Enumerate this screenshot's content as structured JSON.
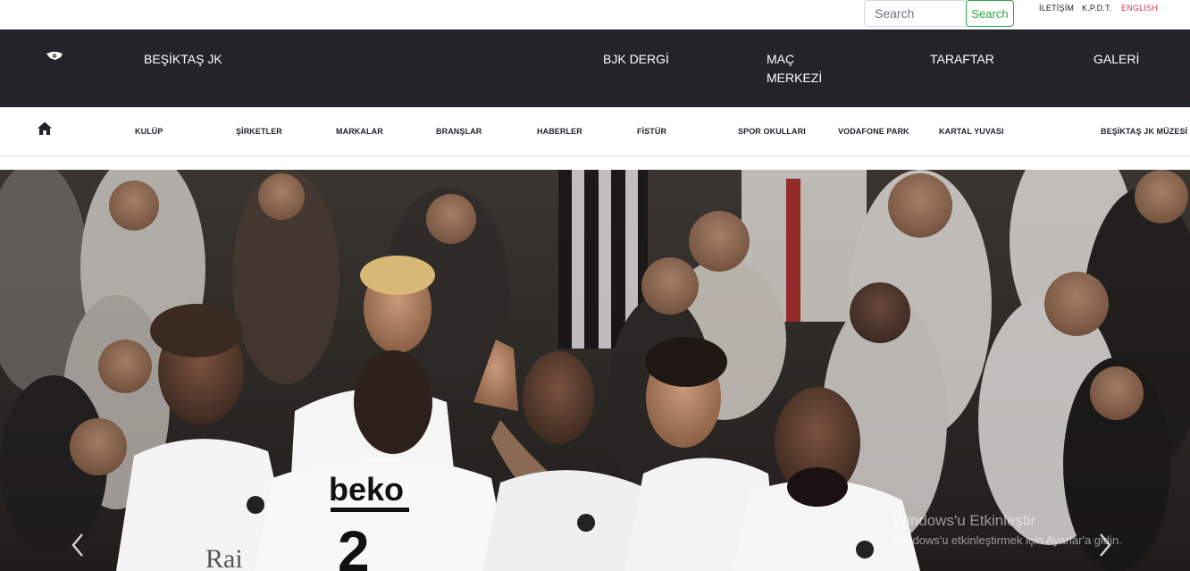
{
  "topbar": {
    "search_placeholder": "Search",
    "search_button": "Search",
    "links": [
      "İLETİŞİM",
      "K.P.D.T.",
      "ENGLISH"
    ]
  },
  "mainnav": {
    "brand": "BEŞİKTAŞ JK",
    "items": [
      "BJK DERGİ",
      "MAÇ",
      "MERKEZİ",
      "TARAFTAR",
      "GALERİ"
    ]
  },
  "subnav": {
    "items": [
      "KULÜP",
      "ŞİRKETLER",
      "MARKALAR",
      "BRANŞLAR",
      "HABERLER",
      "FİSTÜR",
      "SPOR OKULLARI",
      "VODAFONE PARK",
      "KARTAL YUVASI",
      "BEŞİKTAŞ JK MÜZESİ"
    ]
  },
  "hero": {
    "jersey_text": "beko",
    "jersey_number": "2",
    "sponsor_text": "Rai"
  },
  "watermark": {
    "title": "Windows'u Etkinleştir",
    "subtitle": "Windows'u etkinleştirmek için Ayarlar'a gidin."
  },
  "colors": {
    "navbar_dark": "#212529",
    "search_green": "#28a745",
    "accent_red": "#dc3545"
  },
  "icons": [
    "logo-icon",
    "home-icon",
    "chevron-left-icon",
    "chevron-right-icon"
  ]
}
